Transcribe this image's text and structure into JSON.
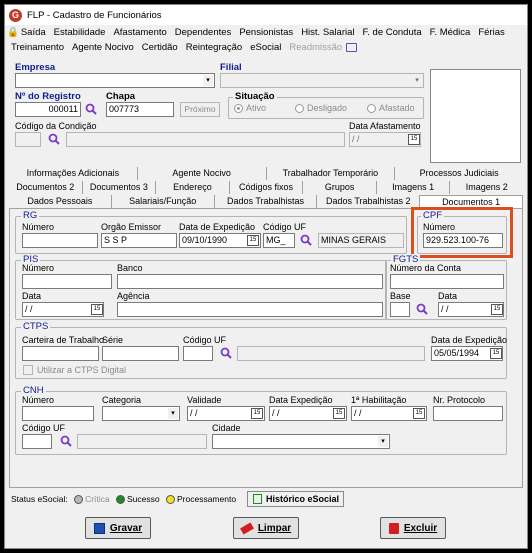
{
  "window": {
    "title": "FLP - Cadastro de Funcionários"
  },
  "menu1": [
    "Saída",
    "Estabilidade",
    "Afastamento",
    "Dependentes",
    "Pensionistas",
    "Hist. Salarial",
    "F. de Conduta",
    "F. Médica",
    "Férias"
  ],
  "menu2": {
    "items": [
      "Treinamento",
      "Agente Nocivo",
      "Certidão",
      "Reintegração",
      "eSocial"
    ],
    "disabled": "Readmissão"
  },
  "header": {
    "empresa_label": "Empresa",
    "filial_label": "Filial",
    "registro_label": "Nº do Registro",
    "registro_value": "000011",
    "chapa_label": "Chapa",
    "chapa_value": "007773",
    "proximo_button": "Próximo",
    "situacao_label": "Situação",
    "situacao_options": [
      "Ativo",
      "Desligado",
      "Afastado"
    ],
    "codigo_condicao_label": "Código da Condição",
    "codigo_condicao_value": "",
    "data_afastamento_label": "Data Afastamento",
    "data_afastamento_value": "/ /"
  },
  "tabs": {
    "row1": [
      "Informações Adicionais",
      "Agente Nocivo",
      "Trabalhador Temporário",
      "Processos Judiciais"
    ],
    "row2": [
      "Documentos 2",
      "Documentos 3",
      "Endereço",
      "Códigos fixos",
      "Grupos",
      "Imagens 1",
      "Imagens 2"
    ],
    "row3": [
      "Dados Pessoais",
      "Salariais/Função",
      "Dados Trabalhistas",
      "Dados Trabalhistas 2",
      "Documentos 1"
    ],
    "active": "Documentos 1"
  },
  "rg": {
    "title": "RG",
    "numero_label": "Número",
    "numero_value": "",
    "orgao_label": "Orgão Emissor",
    "orgao_value": "S S P",
    "data_label": "Data de Expedição",
    "data_value": "09/10/1990",
    "uf_label": "Código UF",
    "uf_value": "MG_",
    "uf_name": "MINAS GERAIS"
  },
  "cpf": {
    "title": "CPF",
    "numero_label": "Número",
    "numero_value": "929.523.100-76"
  },
  "pis": {
    "title": "PIS",
    "numero_label": "Número",
    "banco_label": "Banco",
    "data_label": "Data",
    "data_value": "/ /",
    "agencia_label": "Agência"
  },
  "fgts": {
    "title": "FGTS",
    "conta_label": "Número da Conta",
    "base_label": "Base",
    "base_value": "",
    "data_label": "Data",
    "data_value": "/ /"
  },
  "ctps": {
    "title": "CTPS",
    "carteira_label": "Carteira de Trabalho",
    "serie_label": "Série",
    "uf_label": "Código UF",
    "data_label": "Data de Expedição",
    "data_value": "05/05/1994",
    "digital_label": "Utilizar a CTPS Digital"
  },
  "cnh": {
    "title": "CNH",
    "numero_label": "Número",
    "categoria_label": "Categoria",
    "validade_label": "Validade",
    "validade_value": "/ /",
    "data_exp_label": "Data Expedição",
    "data_exp_value": "/ /",
    "habilitacao_label": "1ª Habilitação",
    "habilitacao_value": "/ /",
    "protocolo_label": "Nr. Protocolo",
    "uf_label": "Código UF",
    "uf_value": "",
    "cidade_label": "Cidade"
  },
  "status": {
    "label": "Status eSocial:",
    "items": [
      "Crítica",
      "Sucesso",
      "Processamento"
    ],
    "historico_button": "Histórico eSocial"
  },
  "buttons": {
    "gravar": "Gravar",
    "limpar": "Limpar",
    "excluir": "Excluir"
  },
  "colors": {
    "accent": "#0f1e8c",
    "highlight": "#d9501e",
    "sucesso": "#1e8c1e",
    "processamento": "#f0e020",
    "critica": "#b5b5b5"
  }
}
